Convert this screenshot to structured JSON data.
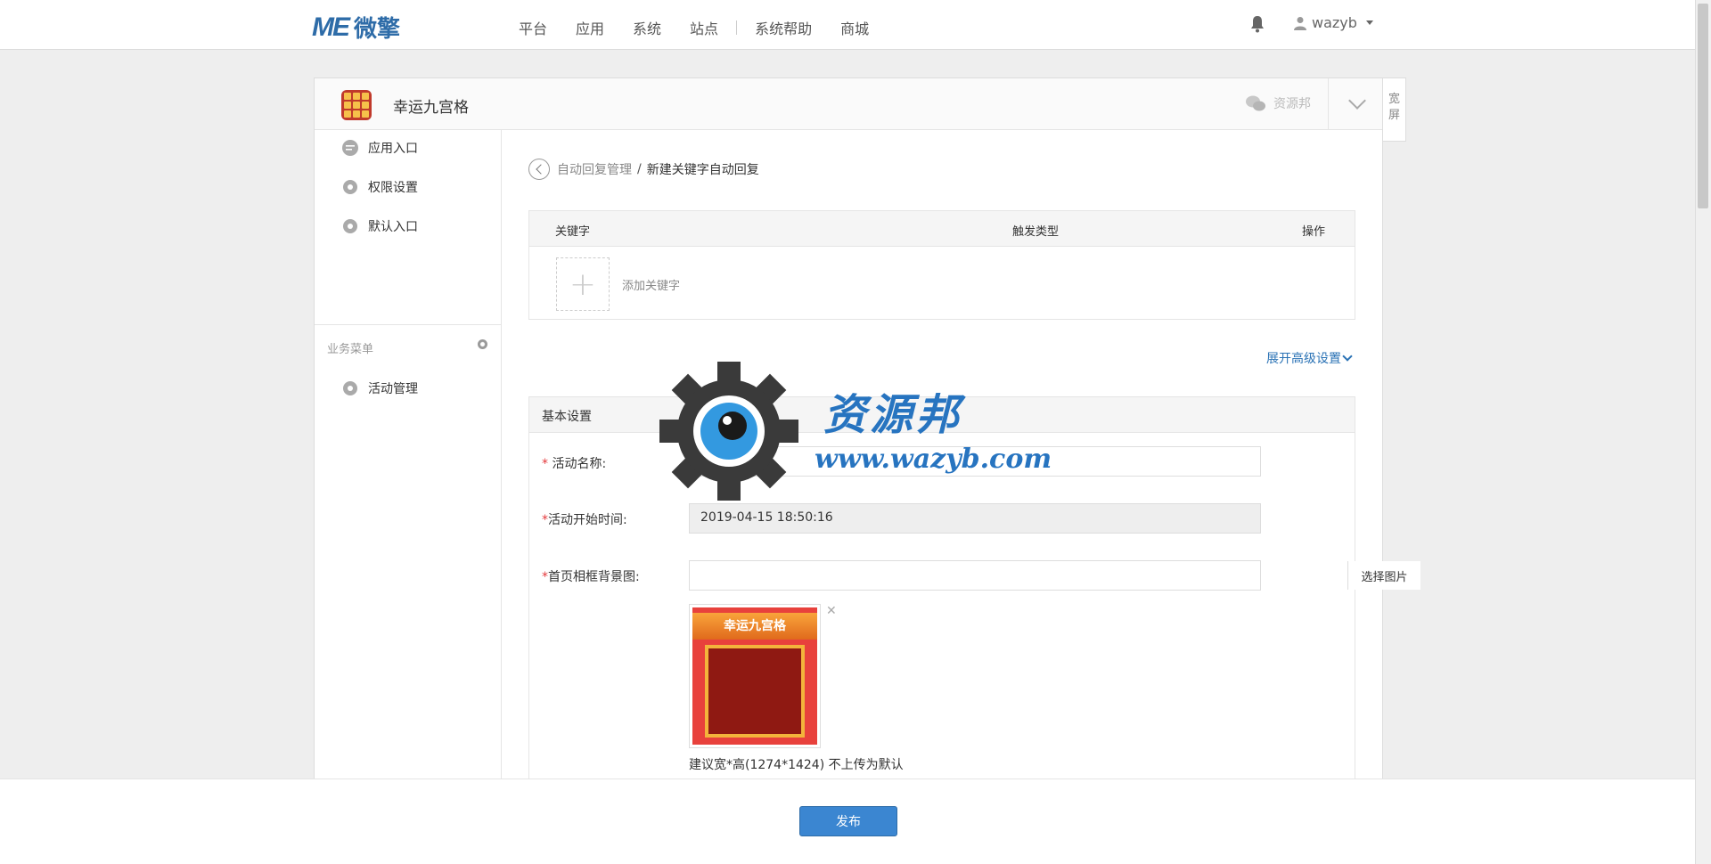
{
  "topbar": {
    "logo_mark": "ME",
    "logo_text": "微擎",
    "nav": [
      "平台",
      "应用",
      "系统",
      "站点",
      "系统帮助",
      "商城"
    ],
    "username": "wazyb"
  },
  "app": {
    "title": "幸运九宫格",
    "account_name": "资源邦",
    "wide_label": "宽屏"
  },
  "sidebar": {
    "items": [
      "应用入口",
      "权限设置",
      "默认入口"
    ],
    "group_label": "业务菜单",
    "group_items": [
      "活动管理"
    ]
  },
  "breadcrumb": {
    "parent": "自动回复管理",
    "separator": "/",
    "current": "新建关键字自动回复"
  },
  "keyword_table": {
    "columns": [
      "关键字",
      "触发类型",
      "操作"
    ],
    "add_label": "添加关键字"
  },
  "advanced_label": "展开高级设置",
  "basic": {
    "title": "基本设置",
    "fields": {
      "name_label": "活动名称:",
      "name_value": "",
      "start_label": "活动开始时间:",
      "start_value": "2019-04-15 18:50:16",
      "bg_label": "首页相框背景图:",
      "bg_value": "",
      "pick_button": "选择图片"
    },
    "thumb_banner": "幸运九宫格",
    "hint": "建议宽*高(1274*1424) 不上传为默认"
  },
  "watermark": {
    "text": "资源邦",
    "url": "www.wazyb.com"
  },
  "footer": {
    "publish_label": "发布"
  },
  "colors": {
    "brand": "#2e6ca8",
    "primary_button": "#3b86d1",
    "link": "#2a72b5",
    "required": "#e4393c"
  }
}
